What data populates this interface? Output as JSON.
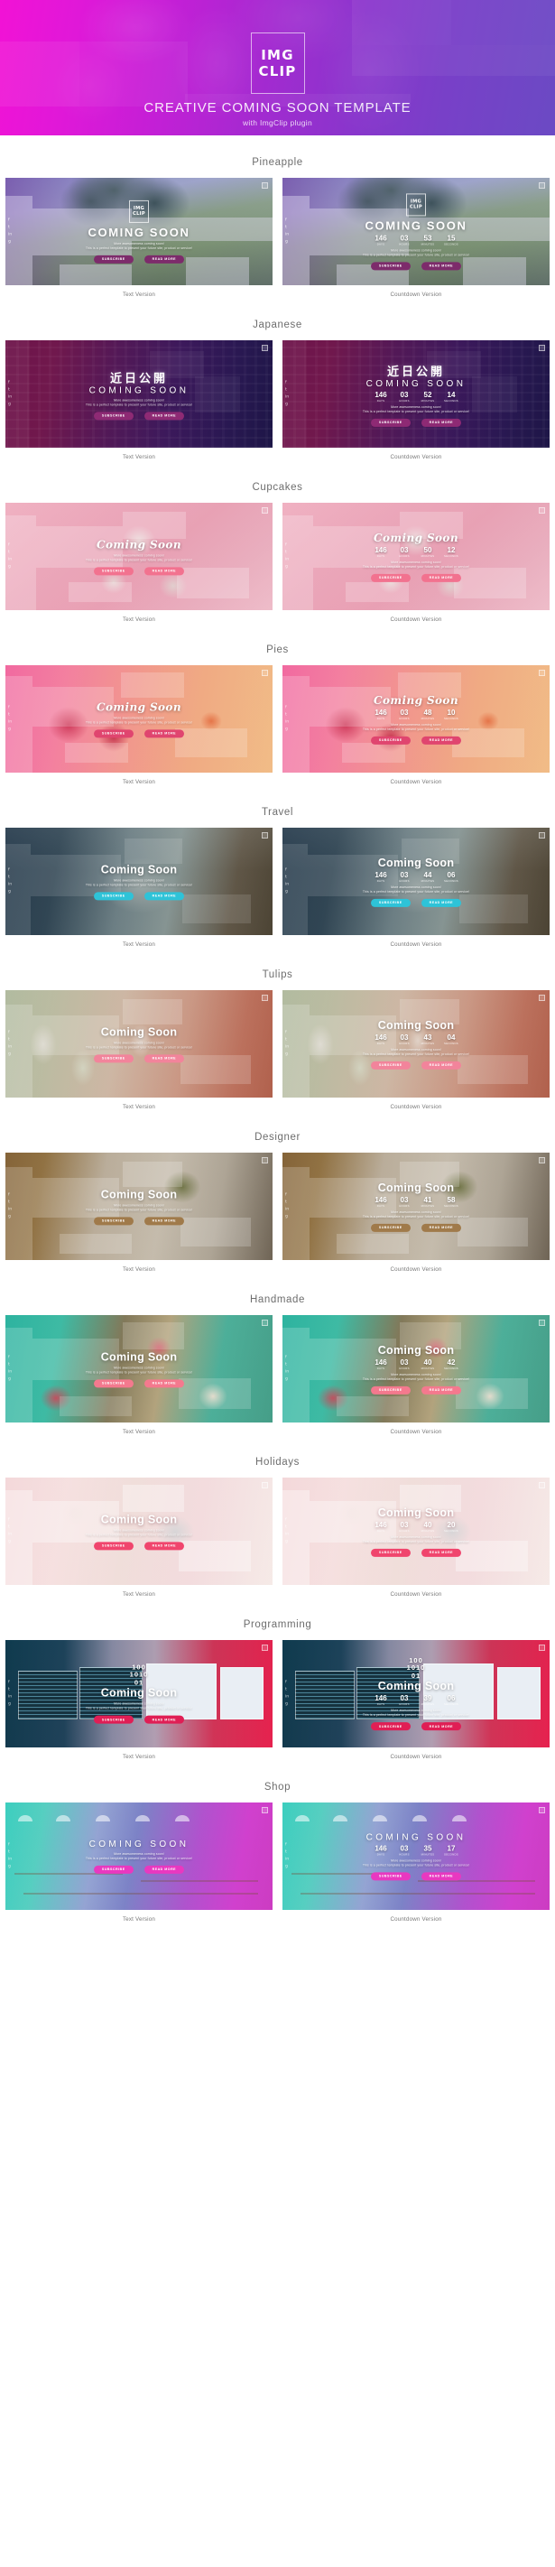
{
  "header": {
    "logo_line1": "IMG",
    "logo_line2": "CLIP",
    "title": "CREATIVE COMING SOON TEMPLATE",
    "subtitle": "with ImgClip plugin"
  },
  "card_common": {
    "logo_line1": "IMG",
    "logo_line2": "CLIP",
    "tagline1": "More awesomeness coming soon!",
    "tagline2": "This is a perfect template to present your future site, product or service!",
    "subscribe_label": "SUBSCRIBE",
    "read_more_label": "READ MORE",
    "caption_text": "Text Version",
    "caption_countdown": "Countdown Version",
    "social_icons": [
      "f",
      "t",
      "in",
      "g"
    ],
    "countdown_labels": [
      "DAYS",
      "HOURS",
      "MINUTES",
      "SECONDS"
    ]
  },
  "sections": [
    {
      "title": "Pineapple",
      "theme": "pineapple",
      "headline": "COMING SOON",
      "headline_style": "headline",
      "show_logo": true,
      "countdown": [
        "146",
        "03",
        "53",
        "15"
      ],
      "accent": "#7d2b6b"
    },
    {
      "title": "Japanese",
      "theme": "japanese",
      "headline": "COMING SOON",
      "headline_style": "headline thin",
      "kanji": "近日公開",
      "show_logo": false,
      "countdown": [
        "146",
        "03",
        "52",
        "14"
      ],
      "accent": "#8e2a74"
    },
    {
      "title": "Cupcakes",
      "theme": "cupcakes",
      "headline": "Coming Soon",
      "headline_style": "headline script",
      "show_logo": false,
      "countdown": [
        "146",
        "03",
        "50",
        "12"
      ],
      "accent": "#f2728f"
    },
    {
      "title": "Pies",
      "theme": "pies",
      "headline": "Coming Soon",
      "headline_style": "headline script",
      "show_logo": false,
      "countdown": [
        "146",
        "03",
        "48",
        "10"
      ],
      "accent": "#e0456f"
    },
    {
      "title": "Travel",
      "theme": "travel",
      "headline": "Coming Soon",
      "headline_style": "headline rounded",
      "show_logo": false,
      "countdown": [
        "146",
        "03",
        "44",
        "06"
      ],
      "accent": "#2ec3d8"
    },
    {
      "title": "Tulips",
      "theme": "tulips",
      "headline": "Coming Soon",
      "headline_style": "headline rounded",
      "show_logo": false,
      "countdown": [
        "146",
        "03",
        "43",
        "04"
      ],
      "accent": "#f2849b"
    },
    {
      "title": "Designer",
      "theme": "designer",
      "headline": "Coming Soon",
      "headline_style": "headline rounded",
      "show_logo": false,
      "countdown": [
        "146",
        "03",
        "41",
        "58"
      ],
      "accent": "#a07a4a"
    },
    {
      "title": "Handmade",
      "theme": "handmade",
      "headline": "Coming Soon",
      "headline_style": "headline rounded",
      "show_logo": false,
      "countdown": [
        "146",
        "03",
        "40",
        "42"
      ],
      "accent": "#f4798e"
    },
    {
      "title": "Holidays",
      "theme": "holidays",
      "headline": "Coming Soon",
      "headline_style": "headline rounded",
      "show_logo": false,
      "countdown": [
        "146",
        "03",
        "40",
        "20"
      ],
      "accent": "#f0456d"
    },
    {
      "title": "Programming",
      "theme": "programming",
      "headline": "Coming Soon",
      "headline_style": "headline rounded",
      "binary": [
        "100",
        "1010",
        "01"
      ],
      "show_logo": false,
      "countdown": [
        "146",
        "03",
        "39",
        "06"
      ],
      "accent": "#e01e55"
    },
    {
      "title": "Shop",
      "theme": "shop",
      "headline": "COMING SOON",
      "headline_style": "headline thin",
      "show_logo": false,
      "countdown": [
        "146",
        "03",
        "35",
        "17"
      ],
      "accent": "#e938c0"
    }
  ]
}
